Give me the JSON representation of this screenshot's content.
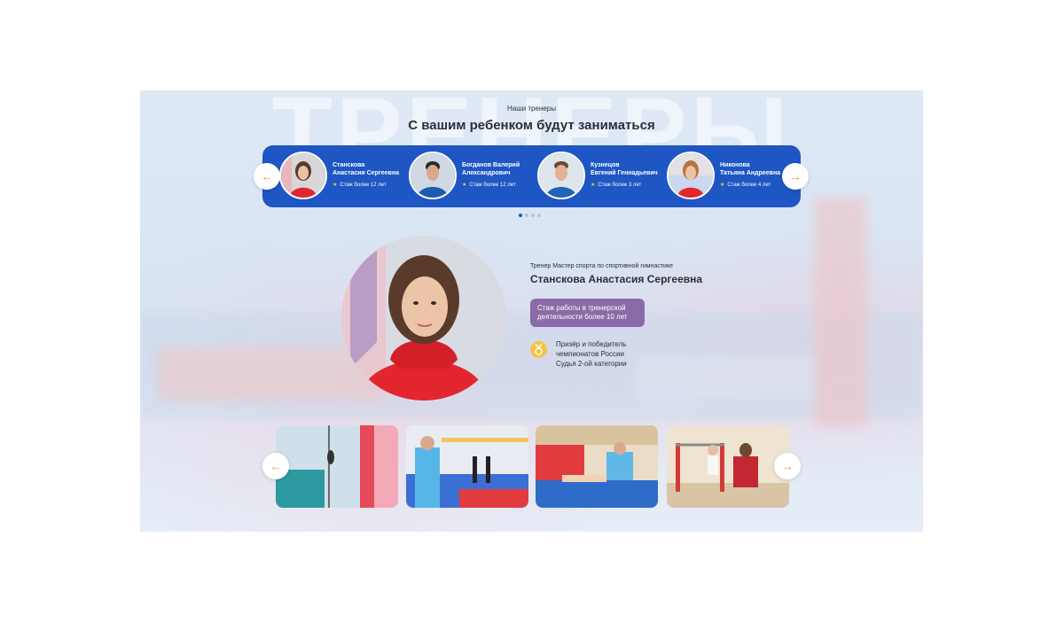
{
  "section": {
    "background_word": "ТРЕНЕРЫ",
    "subtitle": "Наши тренеры",
    "title": "С вашим ребенком будут заниматься"
  },
  "coaches": [
    {
      "name_line1": "Станскова",
      "name_line2": "Анастасия Сергеевна",
      "experience": "Стаж более 12 лет"
    },
    {
      "name_line1": "Богданов Валерий",
      "name_line2": "Александрович",
      "experience": "Стаж более 12 лет"
    },
    {
      "name_line1": "Кузнецов",
      "name_line2": "Евгений Геннадьевич",
      "experience": "Стаж более 3 лет"
    },
    {
      "name_line1": "Никонова",
      "name_line2": "Татьяна Андреевна",
      "experience": "Стаж более 4 лет"
    }
  ],
  "carousel": {
    "total_pages": 4,
    "active_page": 1
  },
  "selected_coach": {
    "role": "Тренер Мастер спорта по спортивной гимнастике",
    "name": "Станскова Анастасия Сергеевна",
    "experience_badge_line1": "Стаж работы в тренерской",
    "experience_badge_line2": "деятельности более 10 лет",
    "achievements_line1": "Призёр и победитель",
    "achievements_line2": "чемпионатов России",
    "achievements_line3": "Судья 2-ой категории"
  },
  "icons": {
    "prev": "arrow-left-icon",
    "next": "arrow-right-icon",
    "experience": "star-icon",
    "award": "medal-icon"
  },
  "colors": {
    "accent_blue": "#1e56c4",
    "badge_purple": "#8a6aa8",
    "arrow_orange": "#f0a23a",
    "star_yellow": "#f5c342"
  }
}
